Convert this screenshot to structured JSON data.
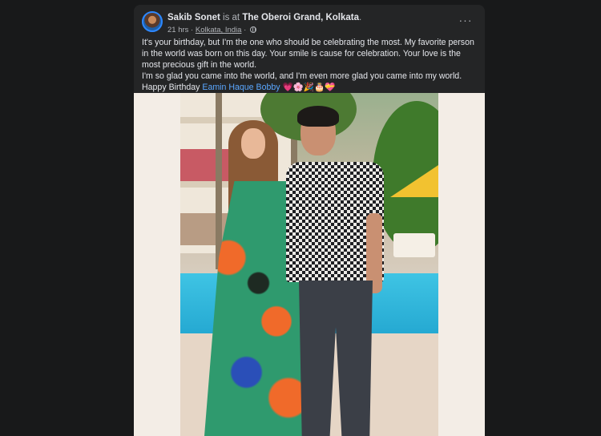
{
  "post": {
    "author": "Sakib Sonet",
    "is_at": "is at",
    "place": "The Oberoi Grand, Kolkata",
    "place_suffix": ".",
    "time": "21 hrs",
    "separator": "·",
    "location": "Kolkata, India",
    "privacy_icon": "globe-icon",
    "more_label": "···",
    "text_line_1": "It's your birthday, but I'm the one who should be celebrating the most. My favorite person in the world was born on this day. Your smile is cause for celebration. Your love is the most precious gift in the world.",
    "text_line_2": "I'm so glad you came into the world, and I'm even more glad you came into my world. Happy Birthday",
    "tagged_person": "Eamin Haque Bobby",
    "emojis": "💗🌸🎉🎂💝"
  },
  "colors": {
    "background": "#18191a",
    "card": "#242526",
    "text": "#e4e6eb",
    "muted": "#b0b3b8",
    "link": "#5aa7ff",
    "photo_margin": "#f3ede6"
  }
}
